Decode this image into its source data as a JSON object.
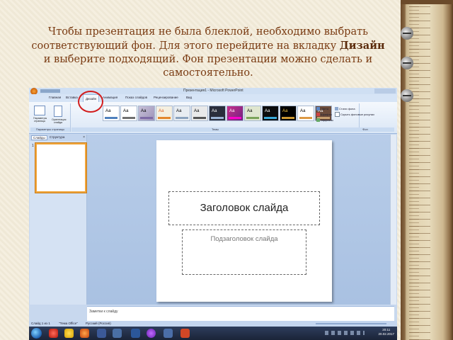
{
  "caption": {
    "part1": "Чтобы презентация не была блеклой, необходимо выбрать соответствующий фон. Для этого перейдите на вкладку ",
    "bold": "Дизайн",
    "part2": " и выберите подходящий. Фон презентации можно сделать и самостоятельно."
  },
  "window": {
    "title": "Презентация1 - Microsoft PowerPoint"
  },
  "ribbon_tabs": [
    {
      "label": "Главная"
    },
    {
      "label": "Вставка"
    },
    {
      "label": "Дизайн",
      "active": true
    },
    {
      "label": "Анимация"
    },
    {
      "label": "Показ слайдов"
    },
    {
      "label": "Рецензирование"
    },
    {
      "label": "Вид"
    }
  ],
  "ribbon": {
    "page_setup": {
      "btn1": "Параметры страницы",
      "btn2": "Ориентация слайда",
      "group_label": "Параметры страницы"
    },
    "themes_group_label": "Темы",
    "theme_sample": "Аа",
    "theme_options": [
      "Цвета",
      "Шрифты",
      "Эффекты"
    ],
    "background": {
      "styles": "Стили фона",
      "hide": "Скрыть фоновые рисунки",
      "group_label": "Фон"
    }
  },
  "left_pane": {
    "tab_slides": "Слайды",
    "tab_outline": "Структура",
    "close": "×",
    "thumb_number": "1"
  },
  "slide": {
    "title_placeholder": "Заголовок слайда",
    "subtitle_placeholder": "Подзаголовок слайда"
  },
  "notes": {
    "placeholder": "Заметки к слайду"
  },
  "status_bar": {
    "slide_info": "Слайд 1 из 1",
    "theme": "\"Тема Office\"",
    "language": "Русский (Россия)"
  },
  "taskbar": {
    "time": "20:11",
    "date": "20.02.2017"
  },
  "colors": {
    "accent_circle": "#d21d1d",
    "caption_text": "#7a3b12",
    "active_thumb_border": "#f1a53a"
  }
}
